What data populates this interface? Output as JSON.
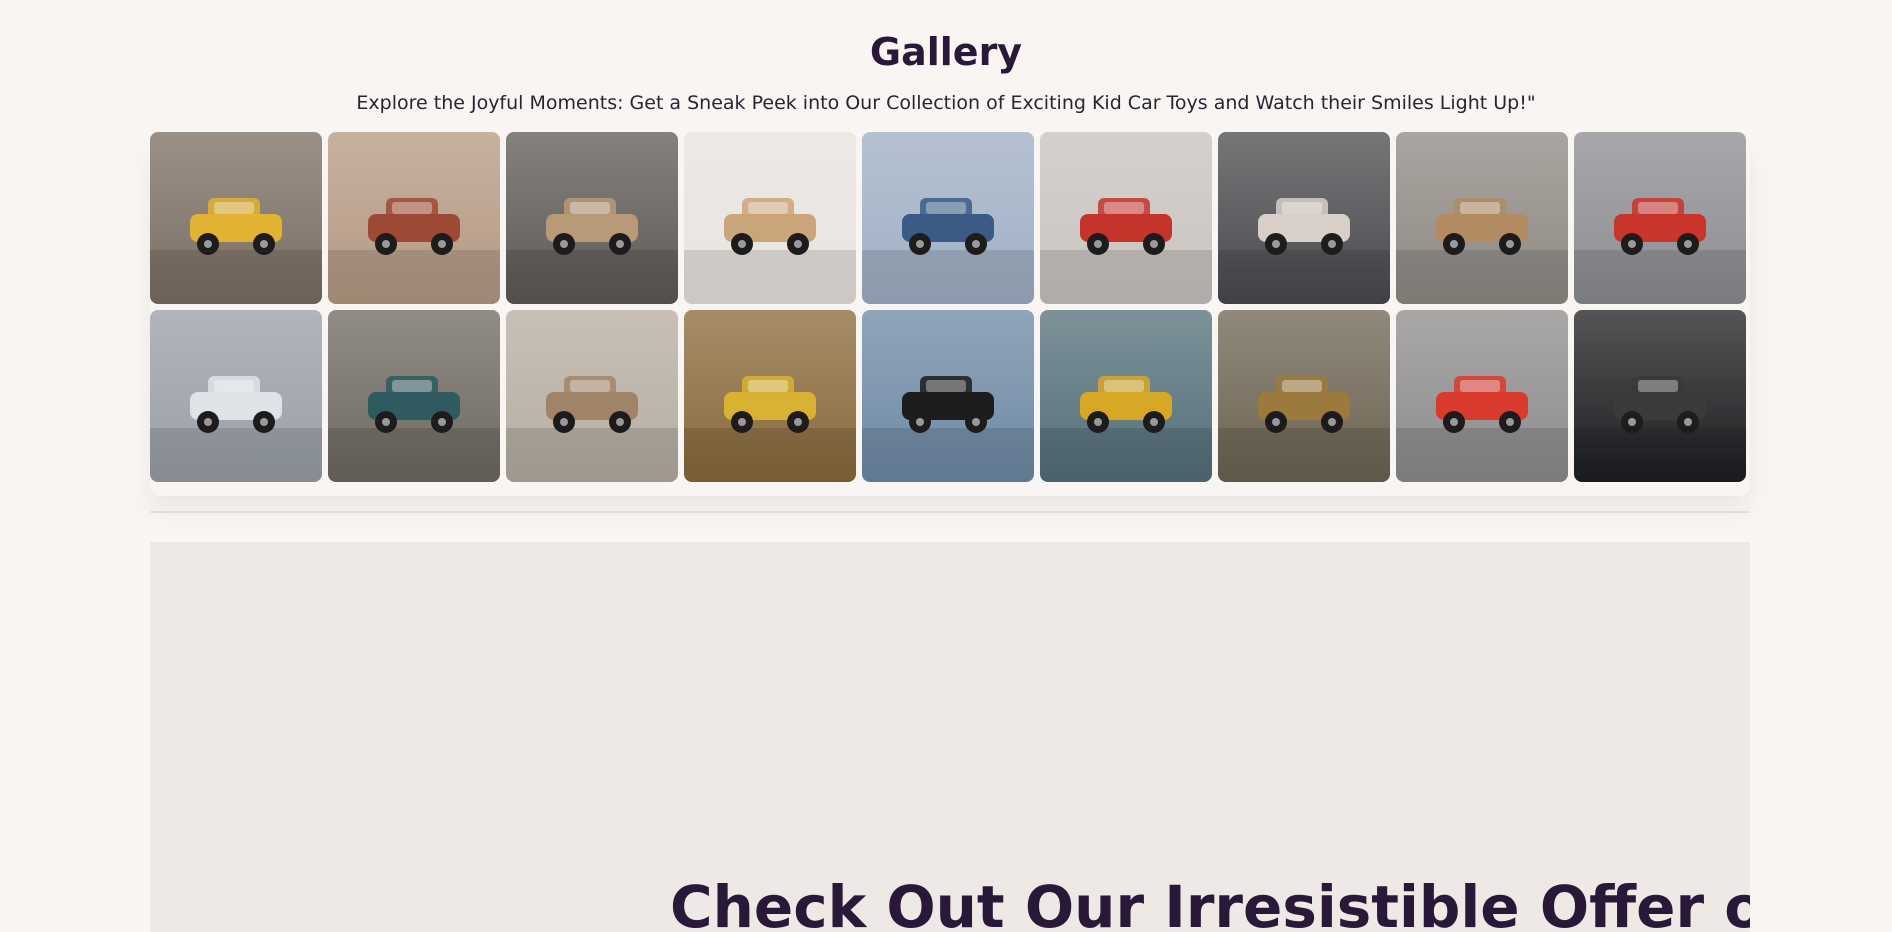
{
  "gallery": {
    "title": "Gallery",
    "subtitle": "Explore the Joyful Moments: Get a Sneak Peek into Our Collection of Exciting Kid Car Toys and Watch their Smiles Light Up!\"",
    "images": [
      {
        "name": "scooter-toy-street-photo",
        "bg": "#7b6f63",
        "accent": "#e2b233"
      },
      {
        "name": "rusty-monster-truck-photo",
        "bg": "#b59a84",
        "accent": "#9c4a36"
      },
      {
        "name": "shark-car-bicycle-photo",
        "bg": "#5e5a55",
        "accent": "#b89a78"
      },
      {
        "name": "wooden-log-car-photo",
        "bg": "#e9e4df",
        "accent": "#caa57a"
      },
      {
        "name": "london-bridge-beetle-photo",
        "bg": "#9fb0c6",
        "accent": "#3b5b84"
      },
      {
        "name": "red-racer-20-photo",
        "bg": "#c9c4bf",
        "accent": "#c4342b"
      },
      {
        "name": "white-offroad-truck-photo",
        "bg": "#4a4b4f",
        "accent": "#d8d0c8"
      },
      {
        "name": "wooden-formula-car-photo",
        "bg": "#8f8a84",
        "accent": "#b38b62"
      },
      {
        "name": "red-wooden-truck-photo",
        "bg": "#8d8e93",
        "accent": "#c9342b"
      },
      {
        "name": "drift-car-in-hand-photo",
        "bg": "#9aa0a8",
        "accent": "#dfe2e6"
      },
      {
        "name": "rusty-van-photo",
        "bg": "#6e6a61",
        "accent": "#2f5a60"
      },
      {
        "name": "beetle-trailer-photo",
        "bg": "#b7aea2",
        "accent": "#a08468"
      },
      {
        "name": "yellow-defender-sand-photo",
        "bg": "#8a6a3a",
        "accent": "#d7b233"
      },
      {
        "name": "black-jeep-in-hand-photo",
        "bg": "#6e8aa6",
        "accent": "#1d1d1d"
      },
      {
        "name": "yellow-jeep-workbench-photo",
        "bg": "#54707a",
        "accent": "#d6a825"
      },
      {
        "name": "rusty-defender-photo",
        "bg": "#6d6452",
        "accent": "#9c7a3e"
      },
      {
        "name": "white-sportscar-in-hand-photo",
        "bg": "#8e8d8d",
        "accent": "#d93a2e"
      },
      {
        "name": "black-porsche-photo",
        "bg": "#1e1f22",
        "accent": "#3a3a3c"
      }
    ]
  },
  "offer": {
    "heading": "Check Out Our Irresistible Offer on"
  }
}
